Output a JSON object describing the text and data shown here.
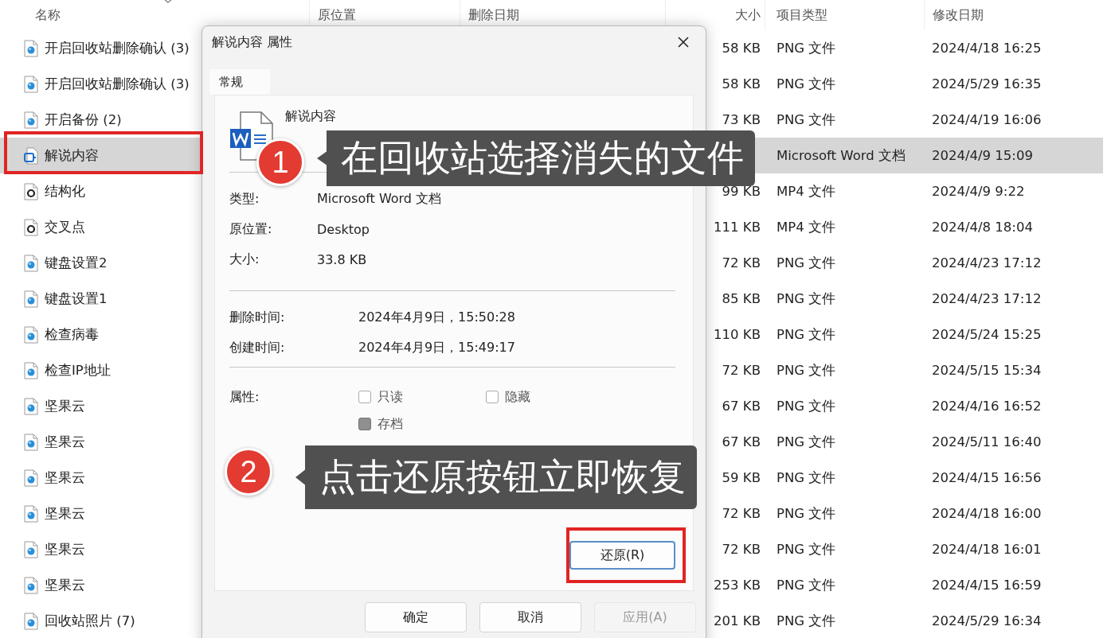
{
  "columns": [
    "名称",
    "原位置",
    "删除日期",
    "大小",
    "项目类型",
    "修改日期"
  ],
  "rows": [
    {
      "name": "开启回收站删除确认 (3)",
      "kind": "image",
      "size": "58 KB",
      "type": "PNG 文件",
      "modified": "2024/4/18 16:25",
      "selected": false
    },
    {
      "name": "开启回收站删除确认 (3)",
      "kind": "image",
      "size": "58 KB",
      "type": "PNG 文件",
      "modified": "2024/5/29 16:35",
      "selected": false
    },
    {
      "name": "开启备份 (2)",
      "kind": "image",
      "size": "73 KB",
      "type": "PNG 文件",
      "modified": "2024/4/19 16:06",
      "selected": false
    },
    {
      "name": "解说内容",
      "kind": "word",
      "type": "Microsoft Word 文档",
      "modified": "2024/4/9 15:09",
      "selected": true
    },
    {
      "name": "结构化",
      "kind": "video",
      "size": "99 KB",
      "type": "MP4 文件",
      "modified": "2024/4/9 9:22",
      "selected": false
    },
    {
      "name": "交叉点",
      "kind": "video",
      "size": "111 KB",
      "type": "MP4 文件",
      "modified": "2024/4/8 18:04",
      "selected": false
    },
    {
      "name": "键盘设置2",
      "kind": "image",
      "size": "72 KB",
      "type": "PNG 文件",
      "modified": "2024/4/23 17:12",
      "selected": false
    },
    {
      "name": "键盘设置1",
      "kind": "image",
      "size": "85 KB",
      "type": "PNG 文件",
      "modified": "2024/4/23 17:12",
      "selected": false
    },
    {
      "name": "检查病毒",
      "kind": "image",
      "size": "110 KB",
      "type": "PNG 文件",
      "modified": "2024/5/24 15:25",
      "selected": false
    },
    {
      "name": "检查IP地址",
      "kind": "image",
      "size": "72 KB",
      "type": "PNG 文件",
      "modified": "2024/5/15 15:34",
      "selected": false
    },
    {
      "name": "坚果云",
      "kind": "image",
      "size": "67 KB",
      "type": "PNG 文件",
      "modified": "2024/4/16 16:52",
      "selected": false
    },
    {
      "name": "坚果云",
      "kind": "image",
      "size": "67 KB",
      "type": "PNG 文件",
      "modified": "2024/5/11 16:40",
      "selected": false
    },
    {
      "name": "坚果云",
      "kind": "image",
      "size": "59 KB",
      "type": "PNG 文件",
      "modified": "2024/4/15 16:56",
      "selected": false
    },
    {
      "name": "坚果云",
      "kind": "image",
      "size": "72 KB",
      "type": "PNG 文件",
      "modified": "2024/4/18 16:00",
      "selected": false
    },
    {
      "name": "坚果云",
      "kind": "image",
      "size": "72 KB",
      "type": "PNG 文件",
      "modified": "2024/4/18 16:01",
      "selected": false
    },
    {
      "name": "坚果云",
      "kind": "image",
      "size": "253 KB",
      "type": "PNG 文件",
      "modified": "2024/4/15 16:59",
      "selected": false
    },
    {
      "name": "回收站照片 (7)",
      "kind": "image",
      "size": "201 KB",
      "type": "PNG 文件",
      "modified": "2024/5/29 16:34",
      "selected": false
    }
  ],
  "dialog": {
    "title": "解说内容 属性",
    "tabs": [
      {
        "label": "常规",
        "selected": true
      }
    ],
    "file_name": "解说内容",
    "details": [
      {
        "label": "类型:",
        "value": "Microsoft Word 文档"
      },
      {
        "label": "原位置:",
        "value": "Desktop"
      },
      {
        "label": "大小:",
        "value": "33.8 KB"
      }
    ],
    "times": [
      {
        "label": "删除时间:",
        "value": "2024年4月9日，15:50:28"
      },
      {
        "label": "创建时间:",
        "value": "2024年4月9日，15:49:17"
      }
    ],
    "attributes_label": "属性:",
    "attributes": [
      {
        "label": "只读",
        "checked": false
      },
      {
        "label": "隐藏",
        "checked": false
      },
      {
        "label": "存档",
        "checked": true
      }
    ],
    "restore_button": "还原(R)",
    "buttons": [
      {
        "label": "确定",
        "disabled": false
      },
      {
        "label": "取消",
        "disabled": false
      },
      {
        "label": "应用(A)",
        "disabled": true
      }
    ]
  },
  "annotations": [
    {
      "number": "1",
      "text": "在回收站选择消失的文件"
    },
    {
      "number": "2",
      "text": "点击还原按钮立即恢复"
    }
  ]
}
